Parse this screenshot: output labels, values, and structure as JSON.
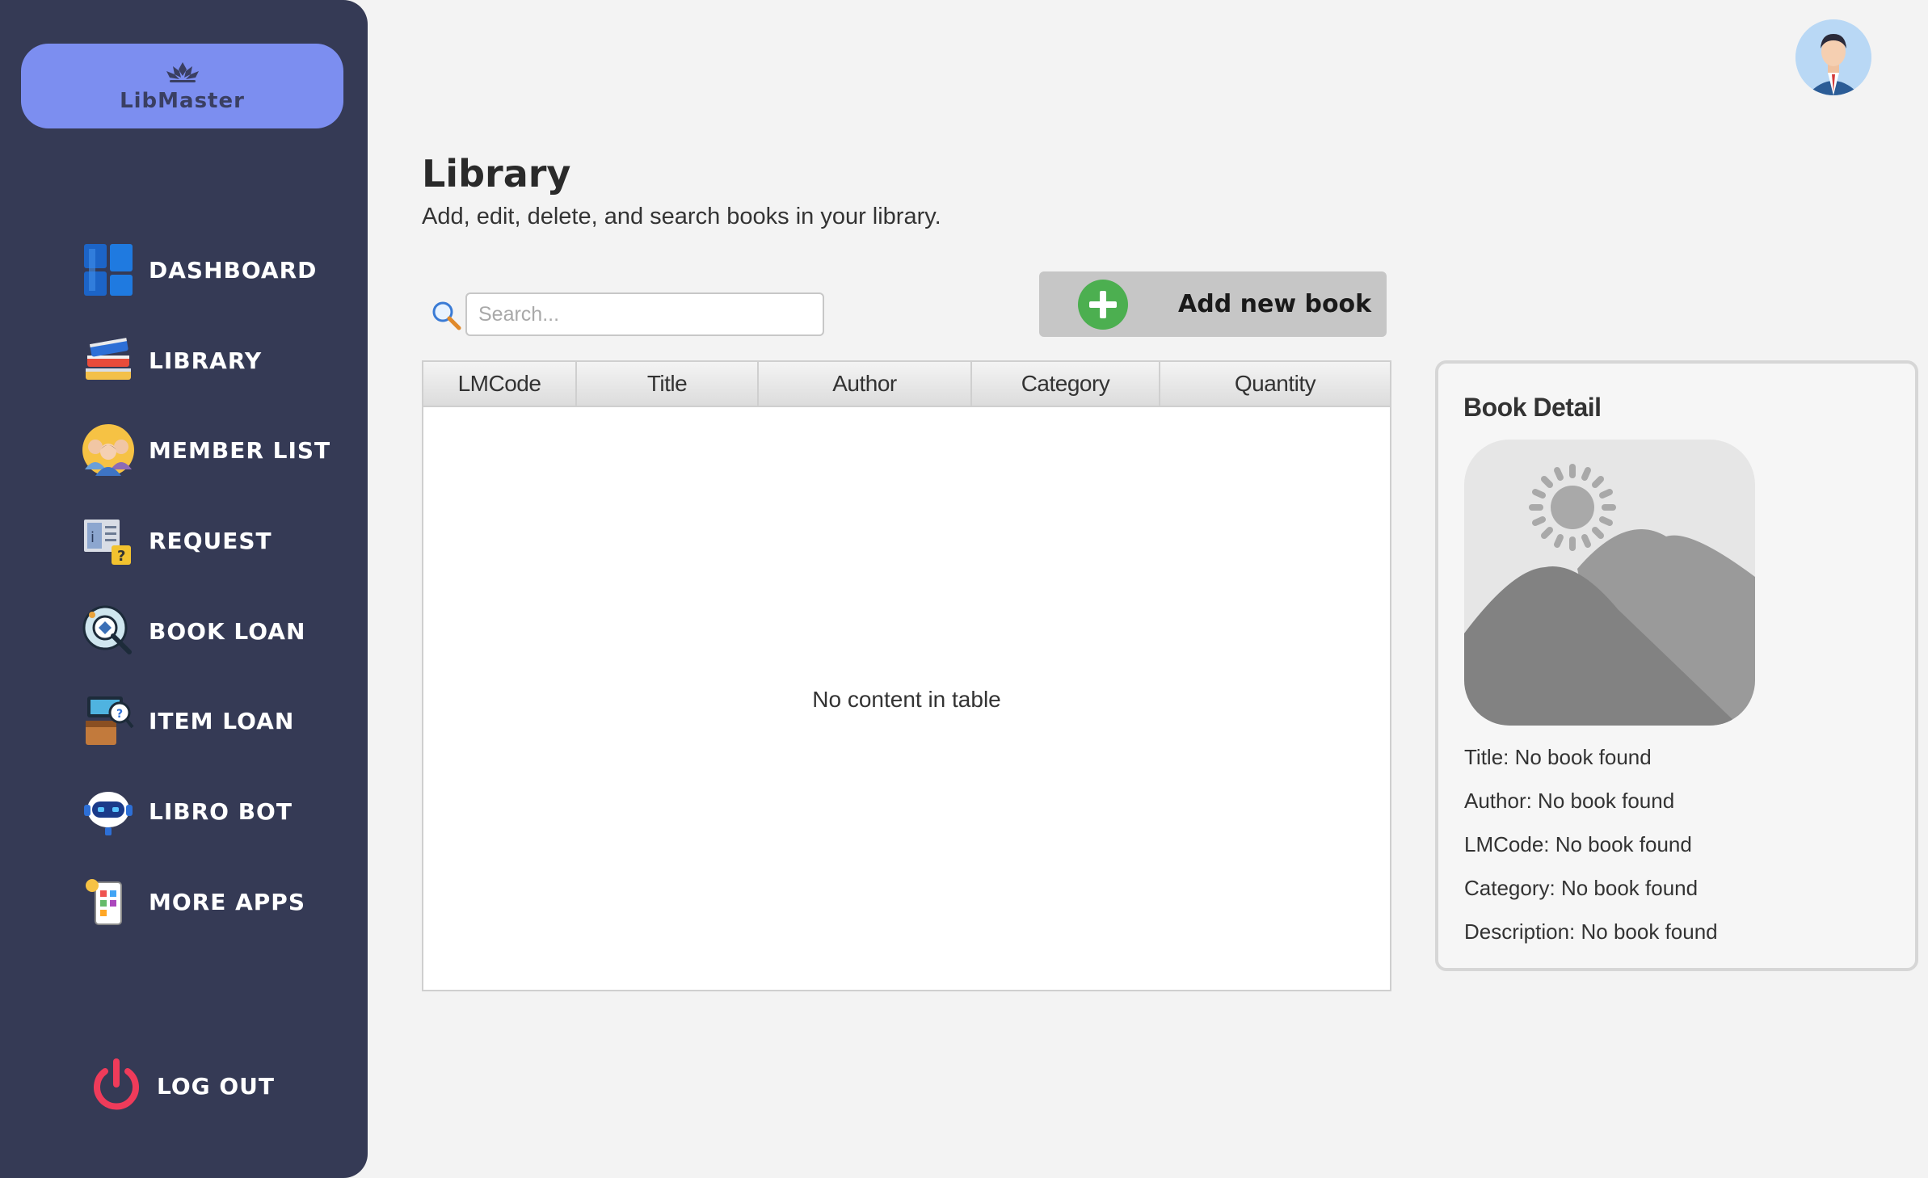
{
  "brand": {
    "name": "LibMaster"
  },
  "sidebar": {
    "items": [
      {
        "label": "DASHBOARD",
        "icon": "dashboard-icon"
      },
      {
        "label": "LIBRARY",
        "icon": "books-icon"
      },
      {
        "label": "MEMBER LIST",
        "icon": "members-icon"
      },
      {
        "label": "REQUEST",
        "icon": "request-icon"
      },
      {
        "label": "BOOK LOAN",
        "icon": "book-loan-icon"
      },
      {
        "label": "ITEM LOAN",
        "icon": "item-loan-icon"
      },
      {
        "label": "LIBRO BOT",
        "icon": "robot-icon"
      },
      {
        "label": "MORE APPS",
        "icon": "apps-icon"
      }
    ],
    "logout": {
      "label": "LOG OUT",
      "icon": "power-icon"
    }
  },
  "header": {
    "title": "Library",
    "subtitle": "Add, edit, delete, and search books in your library."
  },
  "search": {
    "placeholder": "Search...",
    "value": ""
  },
  "toolbar": {
    "add_label": "Add new book"
  },
  "table": {
    "columns": [
      "LMCode",
      "Title",
      "Author",
      "Category",
      "Quantity"
    ],
    "rows": [],
    "empty_message": "No content in table"
  },
  "detail": {
    "title": "Book Detail",
    "lines": [
      "Title:  No book found",
      "Author: No book found",
      "LMCode: No book found",
      "Category:  No book found",
      "Description: No book found"
    ]
  },
  "colors": {
    "sidebar_bg": "#353a55",
    "brand_bg": "#7c8ef0",
    "add_icon": "#4caf50",
    "logout_icon": "#ef3b5a"
  }
}
